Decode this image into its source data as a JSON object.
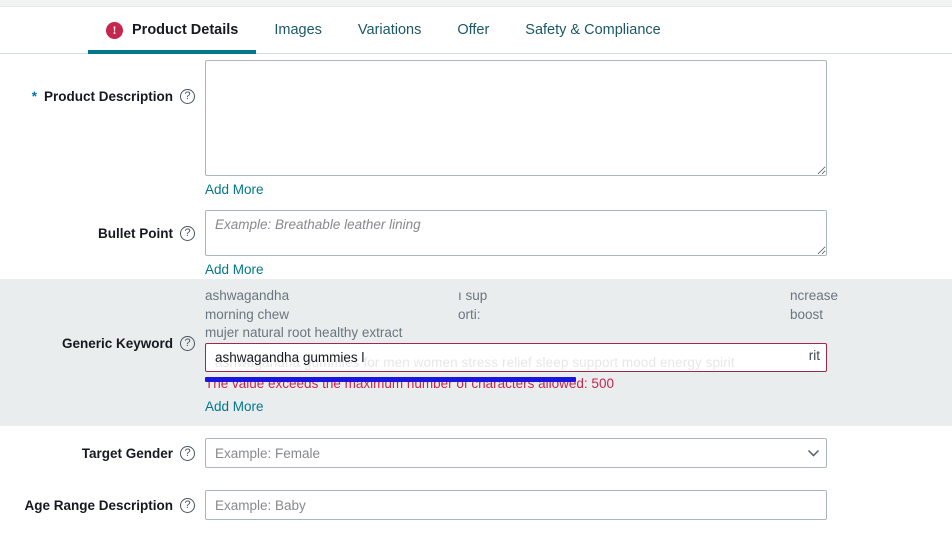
{
  "tabs": [
    {
      "label": "Product Details",
      "active": true,
      "has_error": true,
      "error_glyph": "!"
    },
    {
      "label": "Images",
      "active": false,
      "has_error": false
    },
    {
      "label": "Variations",
      "active": false,
      "has_error": false
    },
    {
      "label": "Offer",
      "active": false,
      "has_error": false
    },
    {
      "label": "Safety & Compliance",
      "active": false,
      "has_error": false
    }
  ],
  "fields": {
    "product_description": {
      "label": "Product Description",
      "required_marker": "*",
      "help_icon": "question-mark-icon",
      "help_glyph": "?",
      "value": "",
      "placeholder": "",
      "add_more": "Add More"
    },
    "bullet_point": {
      "label": "Bullet Point",
      "help_glyph": "?",
      "value": "",
      "placeholder": "Example: Breathable leather lining",
      "add_more": "Add More"
    },
    "generic_keyword": {
      "label": "Generic Keyword",
      "help_glyph": "?",
      "value": "ashwagandha gummies l",
      "ghost_text_faint": "ashwagandha gummies for men women stress relief sleep support mood energy spirit",
      "ghost_text_right": "rit",
      "suggestion_lines": [
        {
          "col1": "ashwagandha",
          "col2": "ı sup",
          "col3": "ncrease"
        },
        {
          "col1": "morning chew",
          "col2": "orti:",
          "col3": "boost"
        },
        {
          "col1": "mujer natural root healthy extract",
          "col2": "",
          "col3": ""
        }
      ],
      "error_message": "The value exceeds the maximum number of characters allowed: 500",
      "add_more": "Add More",
      "highlight_color": "#eaeded",
      "error_border_color": "#a0284a",
      "error_text_color": "#c7254e",
      "annotation_bar_color": "#1a16e0"
    },
    "target_gender": {
      "label": "Target Gender",
      "help_glyph": "?",
      "value": "",
      "placeholder": "Example: Female",
      "chevron_icon": "chevron-down-icon"
    },
    "age_range_description": {
      "label": "Age Range Description",
      "help_glyph": "?",
      "value": "",
      "placeholder": "Example: Baby"
    }
  },
  "colors": {
    "accent_teal": "#00788a",
    "link_teal": "#00788a",
    "error_red": "#c7254e",
    "required_blue": "#0073bb",
    "highlight_bg": "#eaeded"
  }
}
